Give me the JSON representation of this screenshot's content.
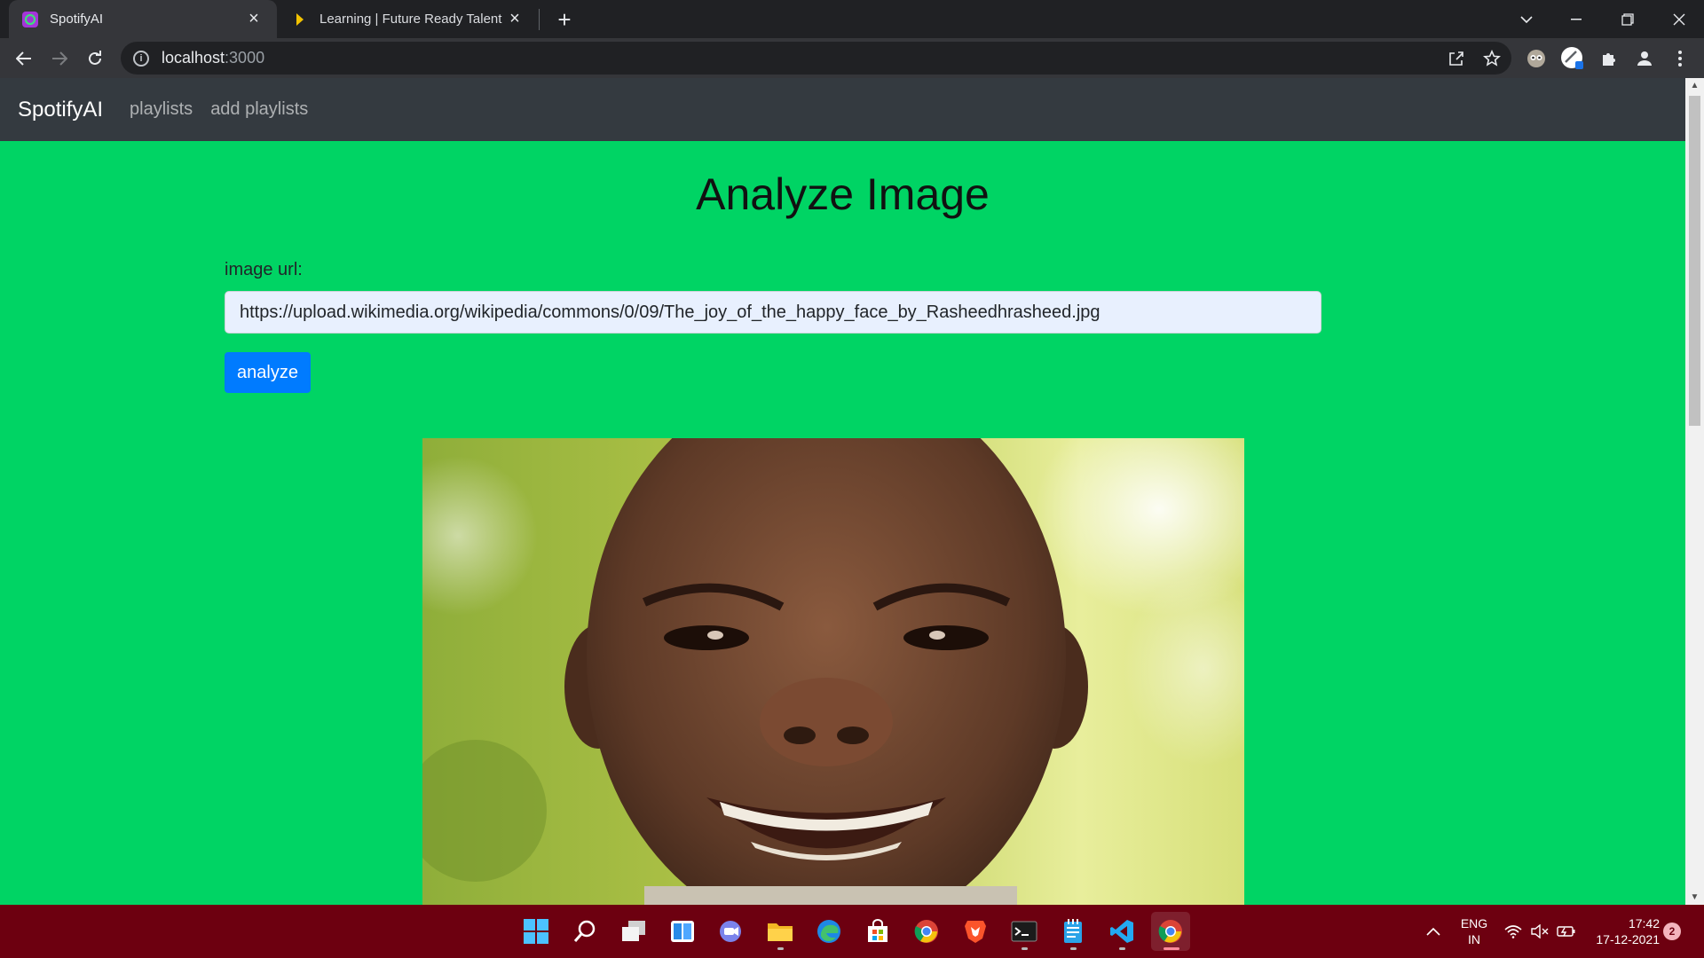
{
  "browser": {
    "tabs": [
      {
        "title": "SpotifyAI",
        "active": true
      },
      {
        "title": "Learning | Future Ready Talent",
        "active": false
      }
    ],
    "address": {
      "host": "localhost",
      "port": ":3000"
    }
  },
  "app": {
    "brand": "SpotifyAI",
    "nav": [
      "playlists",
      "add playlists"
    ]
  },
  "page": {
    "title": "Analyze Image",
    "field_label": "image url:",
    "image_url": "https://upload.wikimedia.org/wikipedia/commons/0/09/The_joy_of_the_happy_face_by_Rasheedhrasheed.jpg",
    "button_label": "analyze"
  },
  "taskbar": {
    "language_top": "ENG",
    "language_bottom": "IN",
    "time": "17:42",
    "date": "17-12-2021",
    "notification_count": "2"
  },
  "colors": {
    "page_background": "#00d464",
    "navbar": "#343a40",
    "button": "#007bff",
    "taskbar": "#6d0010"
  }
}
